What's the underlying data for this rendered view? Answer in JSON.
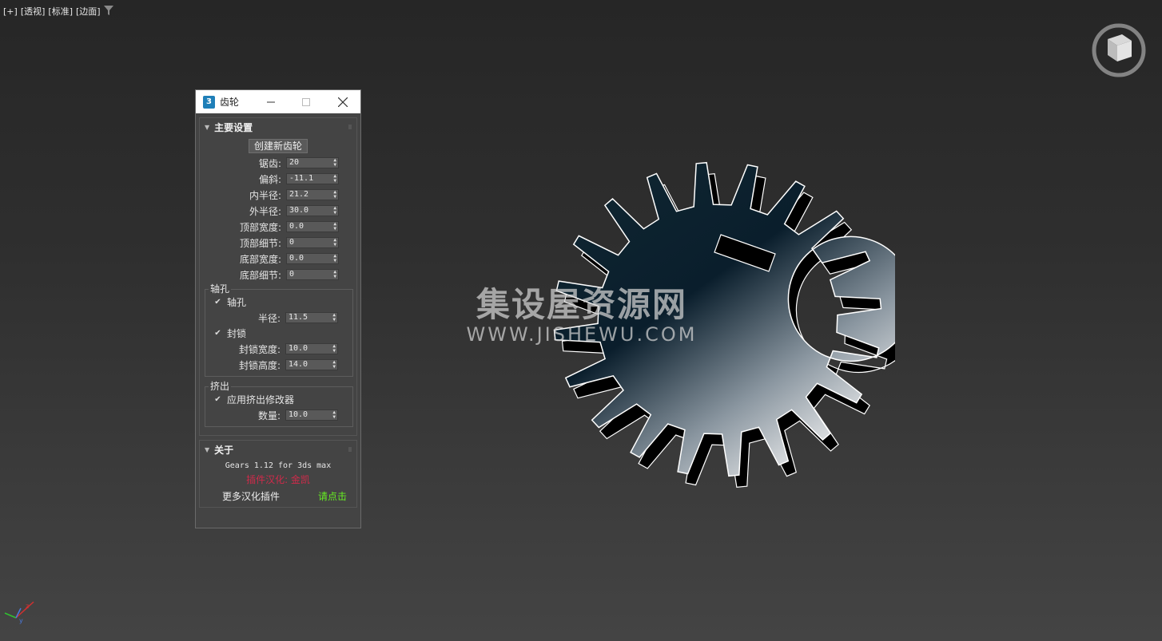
{
  "viewport": {
    "labels": [
      "[+]",
      "[透视]",
      "[标准]",
      "[边面]"
    ]
  },
  "dialog": {
    "title": "齿轮",
    "app_icon_text": "3",
    "main_rollout": {
      "title": "主要设置",
      "create_button": "创建新齿轮",
      "params": [
        {
          "label": "锯齿:",
          "value": "20"
        },
        {
          "label": "偏斜:",
          "value": "-11.1"
        },
        {
          "label": "内半径:",
          "value": "21.2"
        },
        {
          "label": "外半径:",
          "value": "30.0"
        },
        {
          "label": "顶部宽度:",
          "value": "0.0"
        },
        {
          "label": "顶部细节:",
          "value": "0"
        },
        {
          "label": "底部宽度:",
          "value": "0.0"
        },
        {
          "label": "底部细节:",
          "value": "0"
        }
      ],
      "shaft_group": {
        "title": "轴孔",
        "shaft_check": "轴孔",
        "radius_label": "半径:",
        "radius_value": "11.5",
        "lock_check": "封锁",
        "lock_width_label": "封锁宽度:",
        "lock_width_value": "10.0",
        "lock_height_label": "封锁高度:",
        "lock_height_value": "14.0"
      },
      "extrude_group": {
        "title": "挤出",
        "apply_check": "应用挤出修改器",
        "amount_label": "数量:",
        "amount_value": "10.0"
      }
    },
    "about_rollout": {
      "title": "关于",
      "version": "Gears 1.12 for 3ds max",
      "credit": "插件汉化: 金凯",
      "more_label": "更多汉化插件",
      "more_link": "请点击"
    }
  },
  "watermark": {
    "cn": "集设屋资源网",
    "url": "WWW.JISHEWU.COM"
  },
  "colors": {
    "panel_bg": "#444444",
    "credit": "#d02a4a",
    "link": "#66ee22"
  }
}
